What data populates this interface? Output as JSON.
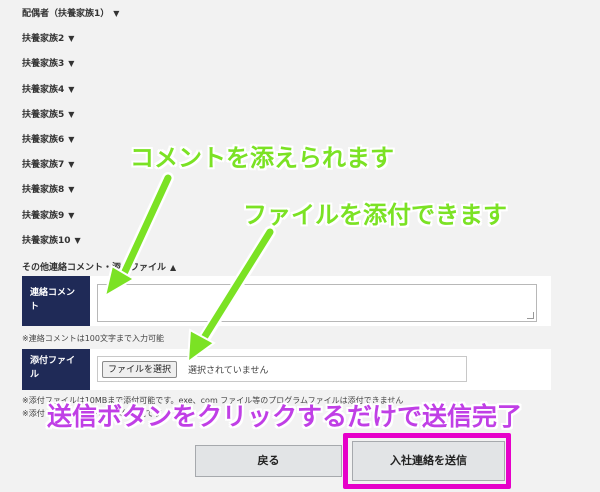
{
  "accordions": [
    {
      "label": "配偶者（扶養家族1）",
      "arrow": "▼"
    },
    {
      "label": "扶養家族2",
      "arrow": "▼"
    },
    {
      "label": "扶養家族3",
      "arrow": "▼"
    },
    {
      "label": "扶養家族4",
      "arrow": "▼"
    },
    {
      "label": "扶養家族5",
      "arrow": "▼"
    },
    {
      "label": "扶養家族6",
      "arrow": "▼"
    },
    {
      "label": "扶養家族7",
      "arrow": "▼"
    },
    {
      "label": "扶養家族8",
      "arrow": "▼"
    },
    {
      "label": "扶養家族9",
      "arrow": "▼"
    },
    {
      "label": "扶養家族10",
      "arrow": "▼"
    }
  ],
  "other_section": {
    "label": "その他連絡コメント・添付ファイル",
    "arrow": "▲"
  },
  "comment_row": {
    "label": "連絡コメント",
    "value": ""
  },
  "comment_note": "※連絡コメントは100文字まで入力可能",
  "file_row": {
    "label": "添付ファイル",
    "button_label": "ファイルを選択",
    "status": "選択されていません"
  },
  "file_note_1": "※添付ファイルは10MBまで添付可能です。exe、com ファイル等のプログラムファイルは添付できません",
  "file_note_2": "※添付ファイルは1件まで添付可能です",
  "buttons": {
    "back": "戻る",
    "submit": "入社連絡を送信"
  },
  "callouts": {
    "comment": "コメントを添えられます",
    "file": "ファイルを添付できます",
    "send": "送信ボタンをクリックするだけで送信完了"
  },
  "colors": {
    "label_bg": "#1f2a57",
    "callout_green": "#7be224",
    "callout_purple": "#c03fe6",
    "highlight": "#e600c9"
  }
}
